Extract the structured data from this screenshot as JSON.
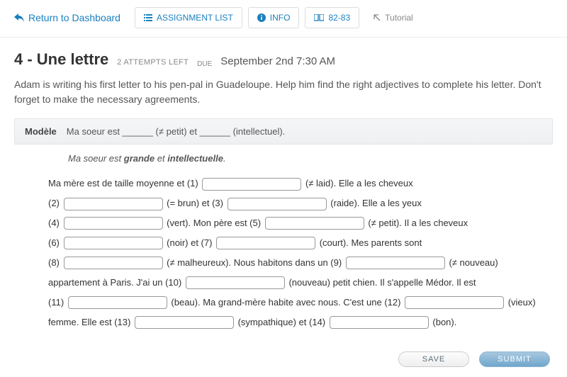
{
  "nav": {
    "return": "Return to Dashboard",
    "assignment_list": "ASSIGNMENT LIST",
    "info": "INFO",
    "pages": "82-83",
    "tutorial": "Tutorial"
  },
  "title": "4 - Une lettre",
  "attempts": "2 ATTEMPTS LEFT",
  "due_label": "DUE",
  "due_value": "September 2nd 7:30 AM",
  "instructions": "Adam is writing his first letter to his pen-pal in Guadeloupe. Help him find the right adjectives to complete his letter. Don't forget to make the necessary agreements.",
  "modele": {
    "label": "Modèle",
    "prompt": "Ma soeur est ______ (≠ petit) et ______ (intellectuel).",
    "answer_pre": "Ma soeur est ",
    "answer_b1": "grande",
    "answer_mid": " et ",
    "answer_b2": "intellectuelle",
    "answer_post": "."
  },
  "exercise": {
    "t1": "Ma mère est de taille moyenne et (1)",
    "h1": "(≠ laid). Elle a les cheveux",
    "t2": "(2)",
    "h2": "(= brun) et (3)",
    "h3": "(raide). Elle a les yeux",
    "t4": "(4)",
    "h4": "(vert). Mon père est (5)",
    "h5": "(≠ petit). Il a les cheveux",
    "t6": "(6)",
    "h6": "(noir) et (7)",
    "h7": "(court). Mes parents sont",
    "t8": "(8)",
    "h8": "(≠ malheureux). Nous habitons dans un (9)",
    "h9": "(≠ nouveau)",
    "t10": "appartement à Paris. J'ai un (10)",
    "h10": "(nouveau) petit chien. Il s'appelle Médor. Il est",
    "t11": "(11)",
    "h11": "(beau). Ma grand-mère habite avec nous. C'est une (12)",
    "h12": "(vieux)",
    "t13": "femme. Elle est (13)",
    "h13": "(sympathique) et (14)",
    "h14": "(bon)."
  },
  "buttons": {
    "save": "SAVE",
    "submit": "SUBMIT"
  }
}
